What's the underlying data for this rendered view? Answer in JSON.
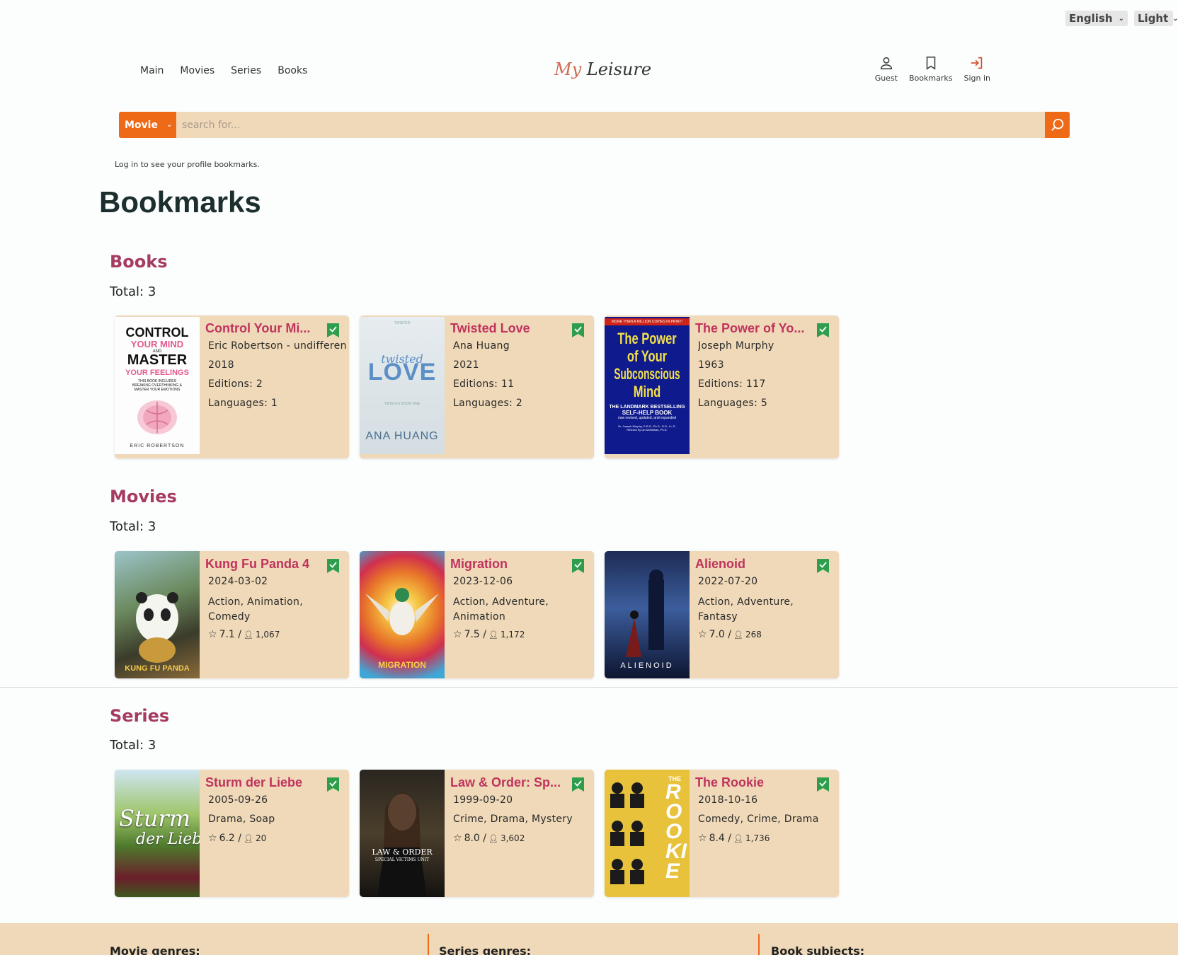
{
  "top": {
    "language": "English",
    "theme": "Light"
  },
  "nav": {
    "main": "Main",
    "movies": "Movies",
    "series": "Series",
    "books": "Books"
  },
  "logo": {
    "my": "My",
    "leisure": "Leisure"
  },
  "user": {
    "guest": "Guest",
    "bookmarks": "Bookmarks",
    "signin": "Sign in"
  },
  "search": {
    "type": "Movie",
    "placeholder": "search for..."
  },
  "hint": "Log in to see your profile bookmarks.",
  "page_title": "Bookmarks",
  "books": {
    "title": "Books",
    "total": "Total: 3",
    "items": [
      {
        "title": "Control Your Mi...",
        "author": "Eric Robertson - undifferen",
        "year": "2018",
        "editions": "Editions:  2",
        "languages": "Languages:  1"
      },
      {
        "title": "Twisted Love",
        "author": "Ana Huang",
        "year": "2021",
        "editions": "Editions:  11",
        "languages": "Languages:  2"
      },
      {
        "title": "The Power of Yo...",
        "author": "Joseph Murphy",
        "year": "1963",
        "editions": "Editions:  117",
        "languages": "Languages:  5"
      }
    ]
  },
  "movies": {
    "title": "Movies",
    "total": "Total: 3",
    "items": [
      {
        "title": "Kung Fu Panda 4",
        "date": "2024-03-02",
        "genres": "Action,  Animation,  Comedy",
        "rating": "7.1 /",
        "votes": "1,067"
      },
      {
        "title": "Migration",
        "date": "2023-12-06",
        "genres": "Action,  Adventure,  Animation",
        "rating": "7.5 /",
        "votes": "1,172"
      },
      {
        "title": "Alienoid",
        "date": "2022-07-20",
        "genres": "Action,  Adventure,  Fantasy",
        "rating": "7.0 /",
        "votes": "268"
      }
    ]
  },
  "series": {
    "title": "Series",
    "total": "Total: 3",
    "items": [
      {
        "title": "Sturm der Liebe",
        "date": "2005-09-26",
        "genres": "Drama,  Soap",
        "rating": "6.2 /",
        "votes": "20"
      },
      {
        "title": "Law & Order: Sp...",
        "date": "1999-09-20",
        "genres": "Crime,  Drama,  Mystery",
        "rating": "8.0 /",
        "votes": "3,602"
      },
      {
        "title": "The Rookie",
        "date": "2018-10-16",
        "genres": "Comedy,  Crime,  Drama",
        "rating": "8.4 /",
        "votes": "1,736"
      }
    ]
  },
  "covers": {
    "book1": {
      "l1": "CONTROL",
      "l2": "YOUR MIND",
      "l3": "AND",
      "l4": "MASTER",
      "l5": "YOUR FEELINGS",
      "l6": "THIS BOOK INCLUDES",
      "l7": "BREAKING OVERTHINKING &",
      "l8": "MASTER YOUR EMOTIONS",
      "author": "ERIC ROBERTSON"
    },
    "book2": {
      "top": "TWISTED",
      "l1": "twisted",
      "l2": "LOVE",
      "sub": "TWISTED BOOK ONE",
      "author": "ANA HUANG"
    },
    "book3": {
      "banner": "MORE THAN A MILLION COPIES IN PRINT!",
      "l1": "The Power",
      "l2": "of Your",
      "l3": "Subconscious",
      "l4": "Mind",
      "l5": "THE LANDMARK BESTSELLING",
      "l6": "SELF-HELP BOOK",
      "l7": "now revised, updated, and expanded",
      "l8": "Dr. Joseph Murphy, D.R.S., Ph.D., D.D., LL.D.",
      "l9": "Revised by Ian McMahan, Ph.D."
    },
    "movie1": {
      "text": "KUNG FU PANDA"
    },
    "movie2": {
      "text": "MIGRATION"
    },
    "movie3": {
      "text": "ALIENOID"
    },
    "series1": {
      "l1": "Sturm",
      "l2": "der Liebe"
    },
    "series2": {
      "l1": "LAW & ORDER",
      "l2": "SPECIAL VICTIMS UNIT"
    },
    "series3": {
      "l1": "THE",
      "l2": "ROOKIE"
    }
  },
  "footer": {
    "col1": "Movie genres:",
    "col2": "Series genres:",
    "col3": "Book subjects:"
  },
  "colors": {
    "accent": "#ee6a16",
    "card": "#efd9b8",
    "title": "#a63b62",
    "badge": "#2e9e4c"
  }
}
